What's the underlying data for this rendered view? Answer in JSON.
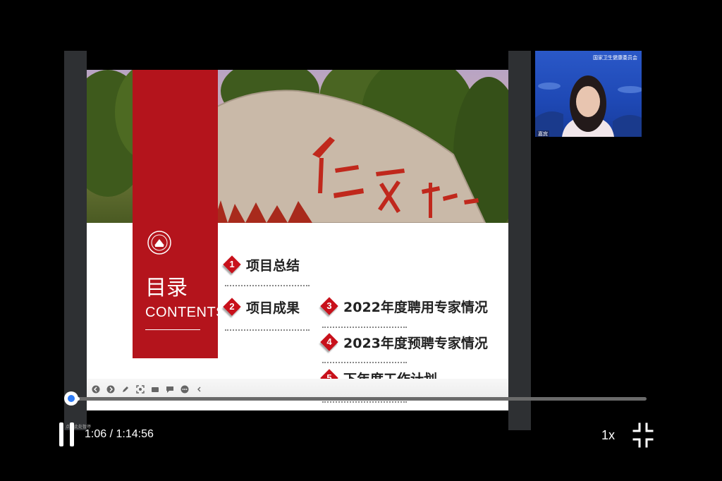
{
  "slide": {
    "toc_title_cn": "目录",
    "toc_title_en": "CONTENTS",
    "stone_text": "仁 爱 精 勤",
    "items": [
      {
        "num": "1",
        "label": "项目总结"
      },
      {
        "num": "2",
        "label": "项目成果"
      },
      {
        "num": "3",
        "label": "2022年度聘用专家情况"
      },
      {
        "num": "4",
        "label": "2023年度预聘专家情况"
      },
      {
        "num": "5",
        "label": "下年度工作计划"
      }
    ],
    "toolbar_icons": [
      "prev-icon",
      "next-icon",
      "pen-icon",
      "screenshot-icon",
      "camera-icon",
      "comment-icon",
      "more-icon",
      "collapse-icon"
    ]
  },
  "webcam": {
    "logo_text": "国家卫生健康委员会",
    "name_tag": "嘉宾"
  },
  "player": {
    "current_time": "1:06",
    "separator": " / ",
    "total_time": "1:14:56",
    "progress_fraction": 0.0147,
    "speed_label": "1x",
    "tiny_caption": "点击此处暂停",
    "accent_color": "#2f7cf6"
  }
}
